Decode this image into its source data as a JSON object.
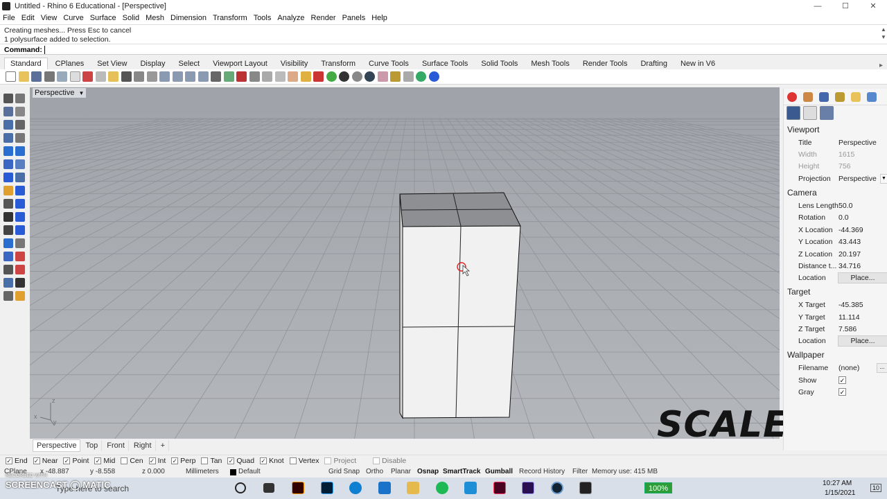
{
  "window": {
    "title": "Untitled - Rhino 6 Educational - [Perspective]",
    "minimize": "—",
    "maximize": "☐",
    "close": "✕"
  },
  "menu": [
    "File",
    "Edit",
    "View",
    "Curve",
    "Surface",
    "Solid",
    "Mesh",
    "Dimension",
    "Transform",
    "Tools",
    "Analyze",
    "Render",
    "Panels",
    "Help"
  ],
  "command": {
    "history": [
      "Creating meshes... Press Esc to cancel",
      "1 polysurface added to selection."
    ],
    "prompt": "Command:"
  },
  "toolbar_tabs": [
    "Standard",
    "CPlanes",
    "Set View",
    "Display",
    "Select",
    "Viewport Layout",
    "Visibility",
    "Transform",
    "Curve Tools",
    "Surface Tools",
    "Solid Tools",
    "Mesh Tools",
    "Render Tools",
    "Drafting",
    "New in V6"
  ],
  "toolbar_more": "▸",
  "viewport": {
    "name": "Perspective",
    "dropdown": "▼",
    "axes": {
      "z": "z",
      "x": "x",
      "y": "y"
    }
  },
  "viewport_tabs": [
    "Perspective",
    "Top",
    "Front",
    "Right"
  ],
  "viewport_add": "+",
  "osnaps": [
    {
      "label": "End",
      "checked": true
    },
    {
      "label": "Near",
      "checked": true
    },
    {
      "label": "Point",
      "checked": true
    },
    {
      "label": "Mid",
      "checked": true
    },
    {
      "label": "Cen",
      "checked": false
    },
    {
      "label": "Int",
      "checked": true
    },
    {
      "label": "Perp",
      "checked": true
    },
    {
      "label": "Tan",
      "checked": false
    },
    {
      "label": "Quad",
      "checked": true
    },
    {
      "label": "Knot",
      "checked": true
    },
    {
      "label": "Vertex",
      "checked": false
    },
    {
      "label": "Project",
      "checked": false,
      "disabled": true
    },
    {
      "label": "Disable",
      "checked": false,
      "disabled": true
    }
  ],
  "status": {
    "cplane": "CPlane",
    "x": "x -48.887",
    "y": "y -8.558",
    "z": "z 0.000",
    "units": "Millimeters",
    "layer": "Default",
    "grid_snap": "Grid Snap",
    "ortho": "Ortho",
    "planar": "Planar",
    "osnap": "Osnap",
    "smarttrack": "SmartTrack",
    "gumball": "Gumball",
    "record_history": "Record History",
    "filter": "Filter",
    "memory": "Memory use: 415 MB"
  },
  "properties": {
    "viewport_header": "Viewport",
    "title_label": "Title",
    "title_value": "Perspective",
    "width_label": "Width",
    "width_value": "1615",
    "height_label": "Height",
    "height_value": "756",
    "projection_label": "Projection",
    "projection_value": "Perspective",
    "camera_header": "Camera",
    "lens_label": "Lens Length",
    "lens_value": "50.0",
    "rotation_label": "Rotation",
    "rotation_value": "0.0",
    "xloc_label": "X Location",
    "xloc_value": "-44.369",
    "yloc_label": "Y Location",
    "yloc_value": "43.443",
    "zloc_label": "Z Location",
    "zloc_value": "20.197",
    "dist_label": "Distance t...",
    "dist_value": "34.716",
    "location_label": "Location",
    "place_button": "Place...",
    "target_header": "Target",
    "xt_label": "X Target",
    "xt_value": "-45.385",
    "yt_label": "Y Target",
    "yt_value": "11.114",
    "zt_label": "Z Target",
    "zt_value": "7.586",
    "tlocation_label": "Location",
    "tplace_button": "Place...",
    "wallpaper_header": "Wallpaper",
    "filename_label": "Filename",
    "filename_value": "(none)",
    "filename_more": "...",
    "show_label": "Show",
    "gray_label": "Gray",
    "check": "✓"
  },
  "watermark": "SCALE",
  "screencast": {
    "brand": "SCREENCAST ◯ MATIC",
    "recorded": "RECORDED WITH",
    "search": "Type here to search"
  },
  "clock": {
    "time": "10:27 AM",
    "date": "1/15/2021",
    "battery": "100%"
  },
  "notification_count": "10"
}
